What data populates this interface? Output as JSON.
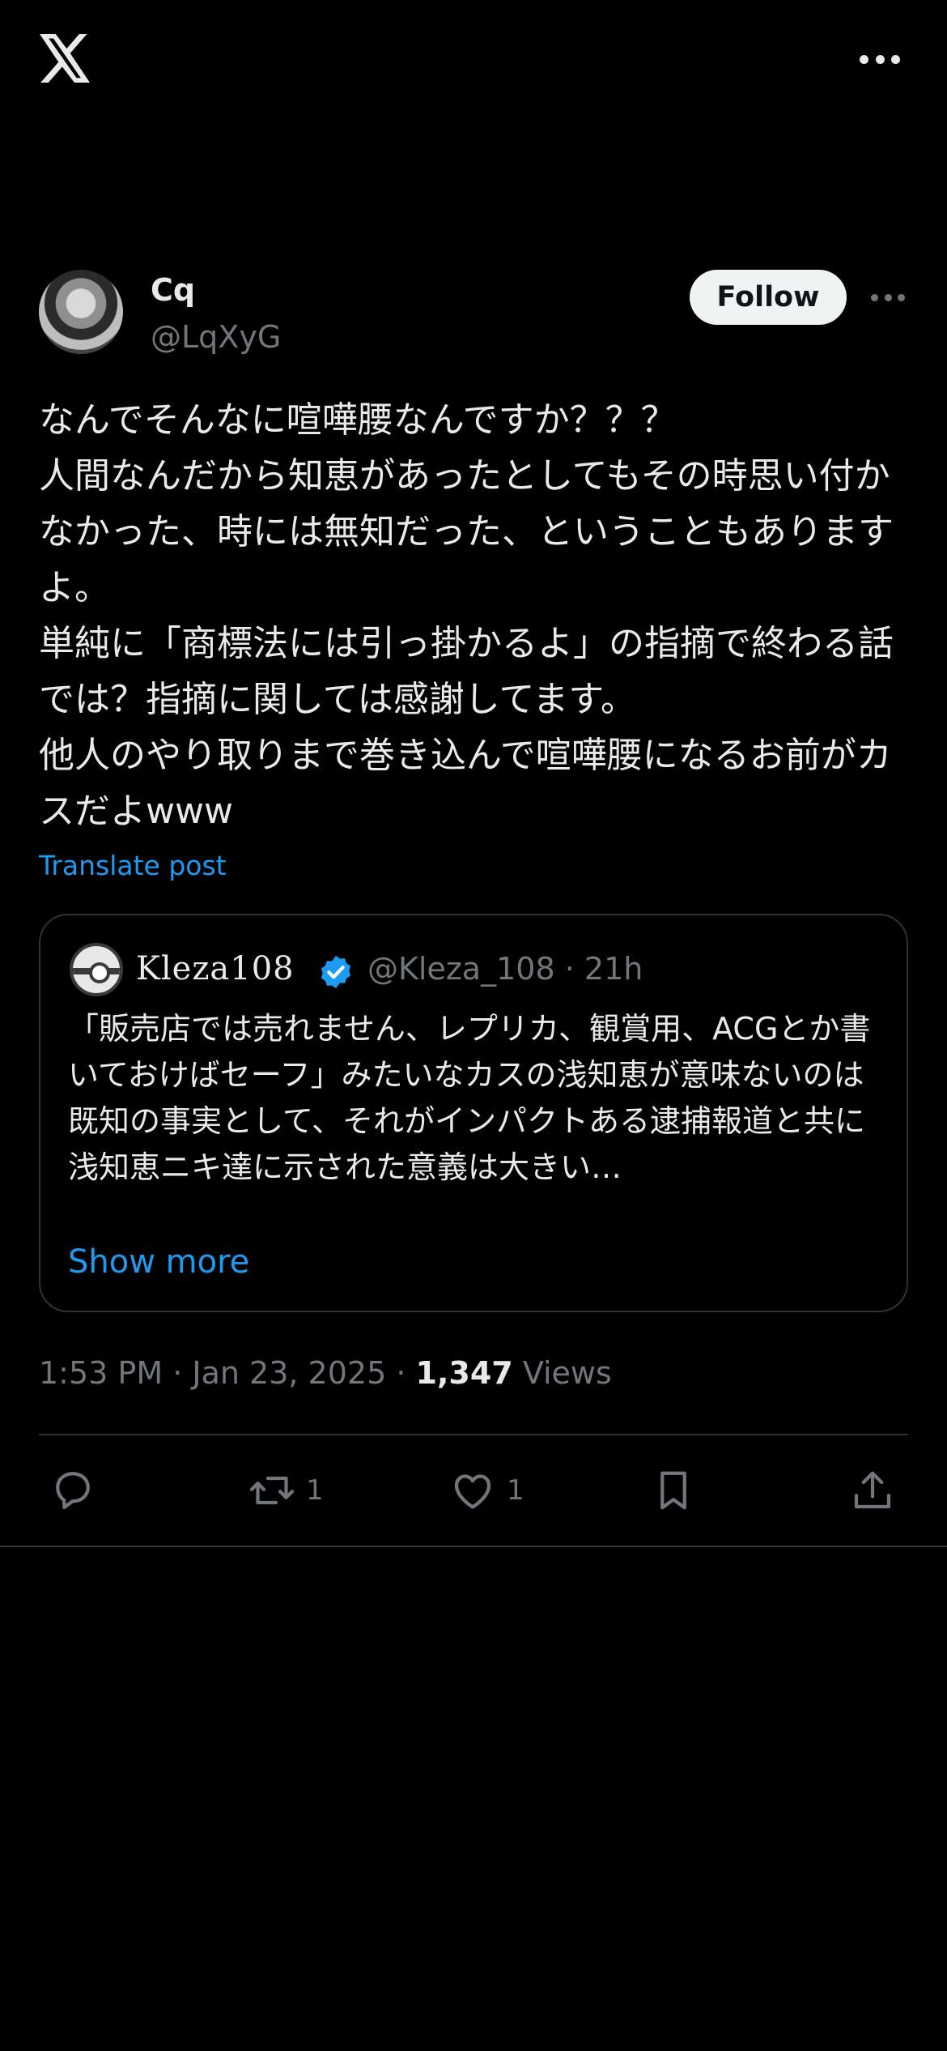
{
  "topbar": {
    "logo": "x-logo-icon",
    "more": "more-icon"
  },
  "author": {
    "name": "Cq",
    "handle": "@LqXyG",
    "follow_label": "Follow"
  },
  "post": {
    "text": "なんでそんなに喧嘩腰なんですか？？？\n人間なんだから知恵があったとしてもその時思い付かなかった、時には無知だった、ということもありますよ。\n単純に「商標法には引っ掛かるよ」の指摘で終わる話では？指摘に関しては感謝してます。\n他人のやり取りまで巻き込んで喧嘩腰になるお前がカスだよwww",
    "translate_label": "Translate post",
    "time": "1:53 PM",
    "date": "Jan 23, 2025",
    "views_count": "1,347",
    "views_label": "Views"
  },
  "quote": {
    "name": "Kleza108",
    "handle": "@Kleza_108",
    "age": "21h",
    "text": "「販売店では売れません、レプリカ、観賞用、ACGとか書いておけばセーフ」みたいなカスの浅知恵が意味ないのは既知の事実として、それがインパクトある逮捕報道と共に浅知恵ニキ達に示された意義は大きい…",
    "show_more_label": "Show more",
    "verified_color": "#1d9bf0"
  },
  "actions": {
    "reply_count": "",
    "retweet_count": "1",
    "like_count": "1"
  },
  "colors": {
    "background": "#000000",
    "text": "#e7e9ea",
    "secondary": "#71767b",
    "accent": "#1d9bf0",
    "border": "#2f3336"
  }
}
